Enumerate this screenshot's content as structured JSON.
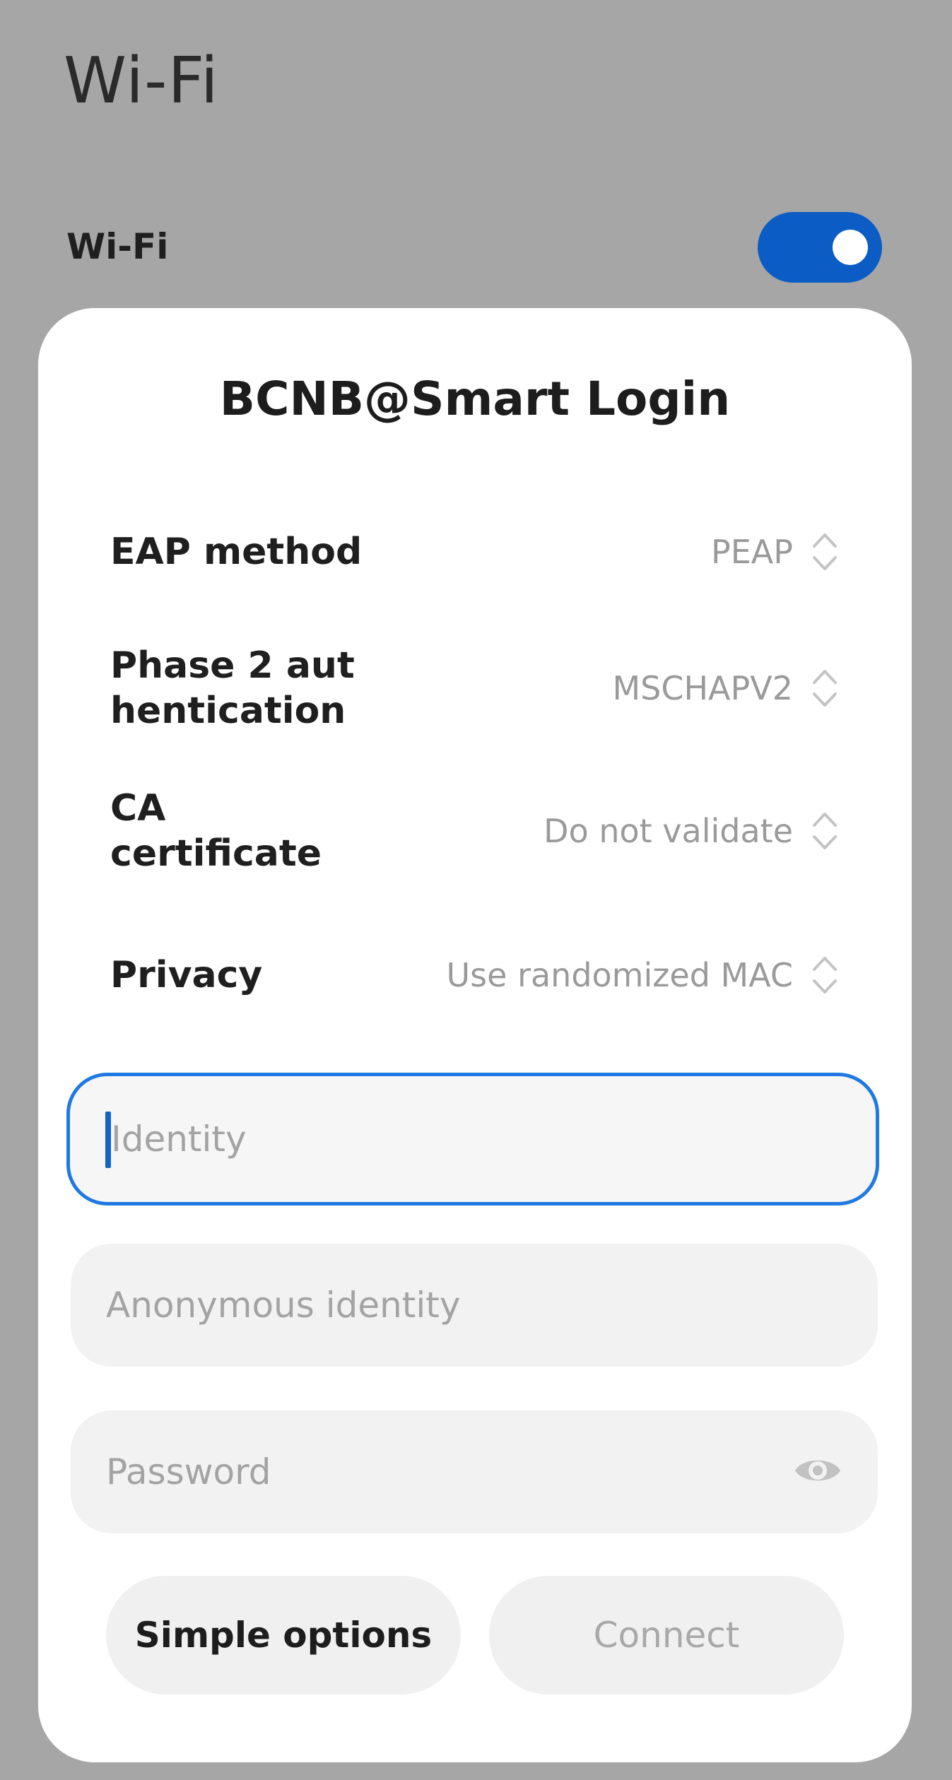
{
  "page": {
    "title": "Wi-Fi"
  },
  "wifi_toggle": {
    "label": "Wi-Fi",
    "state": "on",
    "accent": "#0b5cc4"
  },
  "dialog": {
    "title": "BCNB@Smart Login",
    "settings": [
      {
        "label": "EAP method",
        "value": "PEAP",
        "icon": "up-down-chevron-icon"
      },
      {
        "label": "Phase 2 aut\nhentication",
        "value": "MSCHAPV2",
        "icon": "up-down-chevron-icon"
      },
      {
        "label": "CA\ncertificate",
        "value": "Do not validate",
        "icon": "up-down-chevron-icon"
      },
      {
        "label": "Privacy",
        "value": "Use randomized MAC",
        "icon": "up-down-chevron-icon"
      }
    ],
    "fields": {
      "identity": {
        "placeholder": "Identity",
        "value": "",
        "focused": true
      },
      "anonymous_identity": {
        "placeholder": "Anonymous identity",
        "value": ""
      },
      "password": {
        "placeholder": "Password",
        "value": "",
        "icon": "eye-icon"
      }
    },
    "buttons": {
      "simple_options": "Simple options",
      "connect": "Connect"
    }
  },
  "colors": {
    "scrim": "#a6a6a6",
    "focus_border": "#1e79e2",
    "value_text": "#9a9a9a"
  }
}
